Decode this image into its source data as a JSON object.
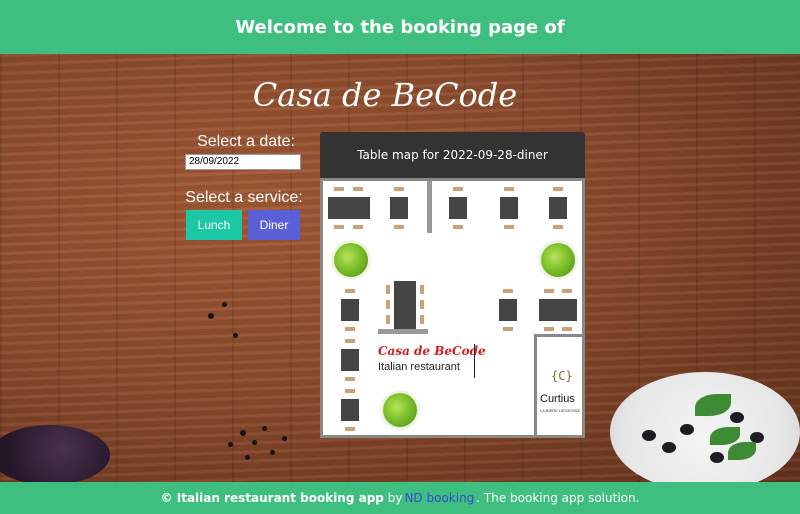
{
  "header": {
    "title": "Welcome to the booking page of"
  },
  "restaurant": {
    "name": "Casa de BeCode"
  },
  "booking": {
    "date_label": "Select a date:",
    "date_value": "28/09/2022",
    "service_label": "Select a service:",
    "services": [
      "Lunch",
      "Diner"
    ]
  },
  "table_map": {
    "title": "Table map for 2022-09-28-diner",
    "logo_name": "Casa de BeCode",
    "logo_subtitle": "Italian restaurant",
    "partner_icon": "{C}",
    "partner_name": "Curtius",
    "partner_tagline": "LA BIÈRE LIÉGEOISE"
  },
  "footer": {
    "prefix": "© Italian restaurant booking app",
    "by": "by",
    "link": "ND booking",
    "suffix": ". The booking app solution."
  },
  "colors": {
    "header_green": "#3fbf7f",
    "lunch_button": "#1cc7a6",
    "diner_button": "#5a5fd6",
    "map_header": "#333333"
  }
}
